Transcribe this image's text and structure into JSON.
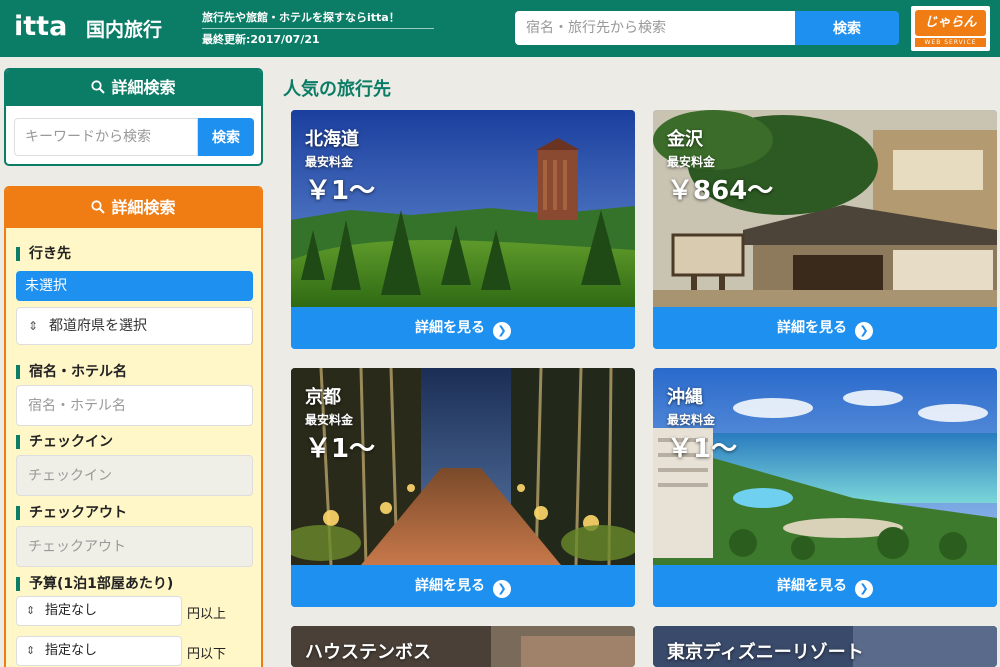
{
  "header": {
    "logo": "itta",
    "logo_sub": "国内旅行",
    "tagline": "旅行先や旅館・ホテルを探すならitta！",
    "updated": "最終更新:2017/07/21",
    "search_placeholder": "宿名・旅行先から検索",
    "search_button": "検索",
    "badge_top": "じゃらん",
    "badge_bottom": "WEB SERVICE"
  },
  "sidebar": {
    "box1": {
      "title": "詳細検索",
      "keyword_placeholder": "キーワードから検索",
      "button": "検索"
    },
    "box2": {
      "title": "詳細検索",
      "destination_label": "行き先",
      "destination_selected": "未選択",
      "prefecture_select": "都道府県を選択",
      "hotel_label": "宿名・ホテル名",
      "hotel_placeholder": "宿名・ホテル名",
      "checkin_label": "チェックイン",
      "checkin_placeholder": "チェックイン",
      "checkout_label": "チェックアウト",
      "checkout_placeholder": "チェックアウト",
      "budget_label": "予算(1泊1部屋あたり)",
      "budget_min": "指定なし",
      "budget_min_unit": "円以上",
      "budget_max": "指定なし",
      "budget_max_unit": "円以下"
    }
  },
  "main": {
    "title": "人気の旅行先",
    "price_label": "最安料金",
    "detail_button": "詳細を見る",
    "cards": [
      {
        "name": "北海道",
        "price": "￥1〜"
      },
      {
        "name": "金沢",
        "price": "￥864〜"
      },
      {
        "name": "京都",
        "price": "￥1〜"
      },
      {
        "name": "沖縄",
        "price": "￥1〜"
      },
      {
        "name": "ハウステンボス",
        "price": ""
      },
      {
        "name": "東京ディズニーリゾート",
        "price": ""
      }
    ]
  },
  "colors": {
    "brand_green": "#0b7d66",
    "accent_blue": "#1e90f0",
    "accent_orange": "#f07c14",
    "panel_yellow": "#fff7c8"
  },
  "icons": {
    "search": "search-icon",
    "select_arrows": "sort-arrows-icon",
    "detail_arrow": "chevron-right-circle-icon"
  }
}
